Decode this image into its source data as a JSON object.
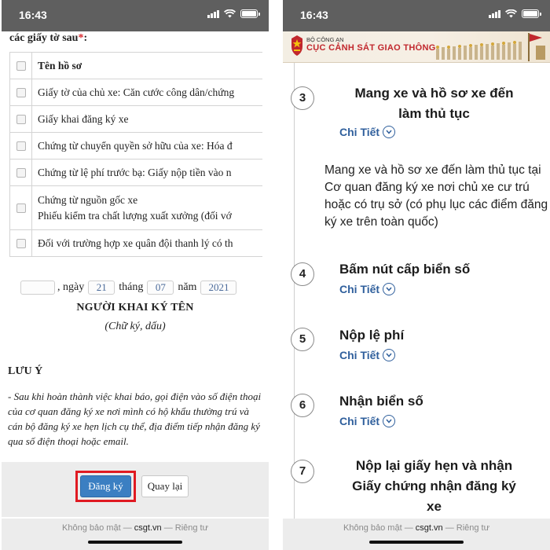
{
  "status_bar": {
    "time": "16:43"
  },
  "left": {
    "heading": "các giấy tờ sau",
    "required_mark": "*",
    "table": {
      "header": "Tên hồ sơ",
      "rows": [
        {
          "line1": "Giấy tờ của chủ xe: Căn cước công dân/chứng",
          "line2": ""
        },
        {
          "line1": "Giấy khai đăng ký xe",
          "line2": ""
        },
        {
          "line1": "Chứng từ chuyển quyền sở hữu của xe: Hóa đ",
          "line2": ""
        },
        {
          "line1": "Chứng từ lệ phí trước bạ: Giấy nộp tiền vào n",
          "line2": ""
        },
        {
          "line1": "Chứng từ nguồn gốc xe",
          "line2": "Phiếu kiểm tra chất lượng xuất xưởng (đối vớ"
        },
        {
          "line1": "Đối với trường hợp xe quân đội thanh lý có th",
          "line2": ""
        }
      ]
    },
    "date": {
      "place_value": "",
      "day_label": ", ngày",
      "day_value": "21",
      "month_label": "tháng",
      "month_value": "07",
      "year_label": "năm",
      "year_value": "2021"
    },
    "signer_title": "NGƯỜI KHAI KÝ TÊN",
    "signer_sub": "(Chữ ký, dấu)",
    "note_title": "LƯU Ý",
    "note_text": "- Sau khi hoàn thành việc khai báo, gọi điện vào số điện thoại của cơ quan đăng ký xe nơi mình có hộ khẩu thường trú và cán bộ đăng ký xe hẹn lịch cụ thể, địa điểm tiếp nhận đăng ký qua số điện thoại hoặc email.",
    "buttons": {
      "submit": "Đăng ký",
      "back": "Quay lại"
    }
  },
  "browser": {
    "left_text": "Không bảo mật —",
    "domain": "csgt.vn",
    "right_text": "— Riêng tư"
  },
  "right": {
    "banner": {
      "small": "BỘ CÔNG AN",
      "big": "CỤC CẢNH SÁT GIAO THÔNG"
    },
    "detail_label": "Chi Tiết",
    "steps": [
      {
        "number": "3",
        "title_line1": "Mang xe và hồ sơ xe đến",
        "title_line2": "làm thủ tục",
        "title_line3": ""
      },
      {
        "number": "4",
        "title_line1": "Bấm nút cấp biển số",
        "title_line2": "",
        "title_line3": ""
      },
      {
        "number": "5",
        "title_line1": "Nộp lệ phí",
        "title_line2": "",
        "title_line3": ""
      },
      {
        "number": "6",
        "title_line1": "Nhận biển số",
        "title_line2": "",
        "title_line3": ""
      },
      {
        "number": "7",
        "title_line1": "Nộp lại giấy hẹn và nhận",
        "title_line2": "Giấy chứng nhận đăng ký",
        "title_line3": "xe"
      }
    ],
    "step3_description": "Mang xe và hồ sơ xe đến làm thủ tục tại Cơ quan đăng ký xe nơi chủ xe cư trú hoặc có trụ sở (có phụ lục các điểm đăng ký xe trên toàn quốc)"
  },
  "colors": {
    "highlight": "#e01a22",
    "primary_button": "#3b7fc2",
    "link": "#2f5f9c",
    "banner_red": "#c1272d"
  }
}
